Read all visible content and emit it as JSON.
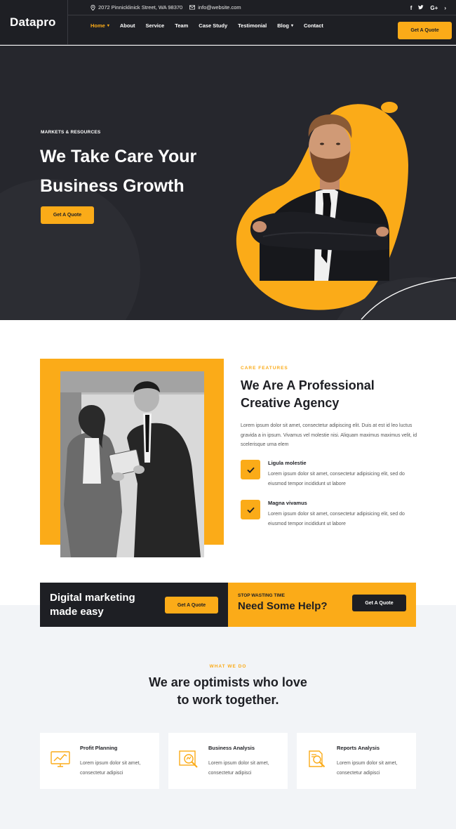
{
  "brand": {
    "logo": "Datapro",
    "accent": "#fbab18",
    "dark": "#1e1f24"
  },
  "topbar": {
    "address": "2072 Pinnicklinick Street, WA 98370",
    "email": "info@website.com",
    "social": [
      "f",
      "t",
      "G+"
    ]
  },
  "nav": {
    "items": [
      {
        "label": "Home",
        "dropdown": true,
        "active": true
      },
      {
        "label": "About",
        "dropdown": false
      },
      {
        "label": "Service",
        "dropdown": false
      },
      {
        "label": "Team",
        "dropdown": false
      },
      {
        "label": "Case Study",
        "dropdown": false
      },
      {
        "label": "Testimonial",
        "dropdown": false
      },
      {
        "label": "Blog",
        "dropdown": true
      },
      {
        "label": "Contact",
        "dropdown": false
      }
    ],
    "quote_label": "Get A Quote"
  },
  "hero": {
    "kicker": "MARKETS & RESOURCES",
    "title_line1": "We Take Care Your",
    "title_line2": "Business Growth",
    "button": "Get A Quote"
  },
  "about": {
    "kicker": "CARE FEATURES",
    "title_line1": "We Are A Professional",
    "title_line2": "Creative Agency",
    "description": "Lorem ipsum dolor sit amet, consectetur adipiscing elit. Duis at est id leo luctus gravida a in ipsum. Vivamus vel molestie nisi. Aliquam maximus maximus velit, id scelerisque urna elem",
    "features": [
      {
        "title": "Ligula molestie",
        "text": "Lorem ipsum dolor sit amet, consectetur adipisicing elit, sed do eiusmod tempor incididunt ut labore"
      },
      {
        "title": "Magna vivamus",
        "text": "Lorem ipsum dolor sit amet, consectetur adipisicing elit, sed do eiusmod tempor incididunt ut labore"
      }
    ]
  },
  "cta": {
    "left_line1": "Digital marketing",
    "left_line2": "made easy",
    "left_button": "Get A Quote",
    "right_kicker": "STOP WASTING TIME",
    "right_title": "Need Some Help?",
    "right_button": "Get A Quote"
  },
  "services": {
    "kicker": "WHAT WE DO",
    "title_line1": "We are optimists who love",
    "title_line2": "to work together.",
    "cards": [
      {
        "title": "Profit Planning",
        "text": "Lorem ipsum dolor sit amet, consectetur adipisci",
        "icon": "chart-monitor-icon"
      },
      {
        "title": "Business Analysis",
        "text": "Lorem ipsum dolor sit amet, consectetur adipisci",
        "icon": "analysis-search-icon"
      },
      {
        "title": "Reports Analysis",
        "text": "Lorem ipsum dolor sit amet, consectetur adipisci",
        "icon": "report-search-icon"
      }
    ]
  }
}
